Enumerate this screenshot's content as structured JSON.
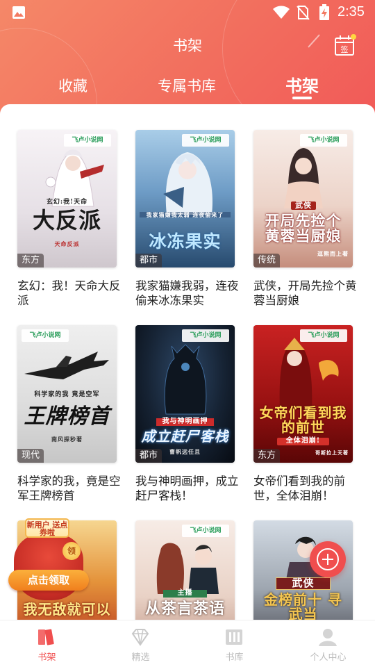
{
  "status_bar": {
    "time": "2:35"
  },
  "header": {
    "title": "书架",
    "tabs": [
      {
        "label": "收藏"
      },
      {
        "label": "专属书库"
      },
      {
        "label": "书架"
      }
    ],
    "checkin_label": "签"
  },
  "books": [
    {
      "title": "玄幻：我！天命大反派",
      "genre": "东方",
      "cover_text_top": "玄幻:我!天命",
      "cover_text": "大反派",
      "cover_author": "天命反派",
      "colors": [
        "#f3eef2",
        "#d9d4dc"
      ]
    },
    {
      "title": "我家猫嫌我弱，连夜偷来冰冻果实",
      "genre": "都市",
      "cover_text_top": "我家猫嫌我太弱 连夜偷来了",
      "cover_text": "冰冻果实",
      "cover_author": "",
      "colors": [
        "#8ab7de",
        "#2f5f8e"
      ]
    },
    {
      "title": "武侠，开局先捡个黄蓉当厨娘",
      "genre": "传统",
      "cover_text_top": "武侠",
      "cover_text": "开局先捡个黄蓉当厨娘",
      "cover_author": "逗熊而上著",
      "colors": [
        "#f4e3dc",
        "#c98f82"
      ]
    },
    {
      "title": "科学家的我，竟是空军王牌榜首",
      "genre": "现代",
      "cover_text_top": "科学家的我 竟是空军",
      "cover_text": "王牌榜首",
      "cover_author": "南风探秒著",
      "colors": [
        "#e6e6e6",
        "#bdbdbd"
      ]
    },
    {
      "title": "我与神明画押，成立赶尸客栈！",
      "genre": "都市",
      "cover_text_top": "我与神明画押",
      "cover_text": "成立赶尸客栈",
      "cover_author": "曹帆远任且",
      "colors": [
        "#1d2a3b",
        "#0b1119"
      ]
    },
    {
      "title": "女帝们看到我的前世，全体泪崩！",
      "genre": "东方",
      "cover_text_top": "",
      "cover_text": "女帝们看到我的前世",
      "cover_author": "哥斯拉上天著",
      "sub_banner": "全体泪崩!",
      "colors": [
        "#b01818",
        "#5e0707"
      ]
    },
    {
      "title": "",
      "genre": "",
      "cover_text_top": "",
      "cover_text": "我无敌就可以",
      "cover_author": "",
      "colors": [
        "#f4c978",
        "#b52d1e"
      ]
    },
    {
      "title": "",
      "genre": "",
      "cover_text_top": "主播",
      "cover_text": "从茶言茶语",
      "cover_author": "",
      "colors": [
        "#f3e6df",
        "#c7a393"
      ]
    },
    {
      "title": "",
      "genre": "",
      "cover_text_top": "武侠",
      "cover_text": "金榜前十 寻武当",
      "cover_author": "",
      "colors": [
        "#c9d3de",
        "#3d3d45"
      ]
    }
  ],
  "promo": {
    "ribbon": "新用户 送点券啦",
    "coin": "领",
    "button": "点击领取"
  },
  "bottom_nav": [
    {
      "label": "书架",
      "icon": "bookshelf-icon",
      "active": true
    },
    {
      "label": "精选",
      "icon": "diamond-icon",
      "active": false
    },
    {
      "label": "书库",
      "icon": "library-icon",
      "active": false
    },
    {
      "label": "个人中心",
      "icon": "person-icon",
      "active": false
    }
  ],
  "colors": {
    "accent": "#f04e4e",
    "header": "#f26e5e"
  }
}
